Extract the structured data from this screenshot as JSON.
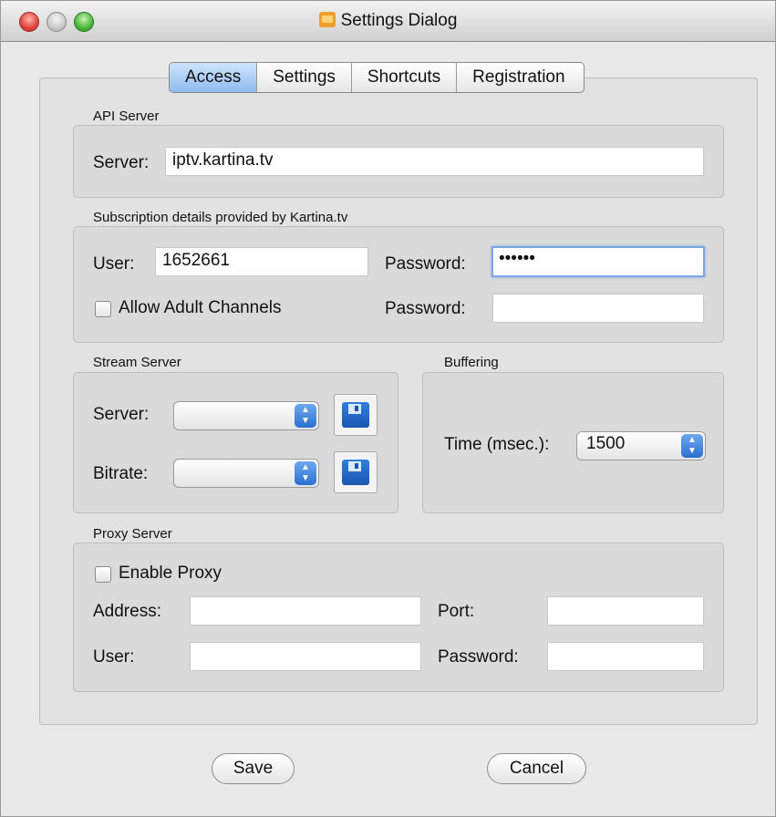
{
  "window": {
    "title": "Settings Dialog"
  },
  "tabs": [
    "Access",
    "Settings",
    "Shortcuts",
    "Registration"
  ],
  "api_server": {
    "group_label": "API Server",
    "server_label": "Server:",
    "server_value": "iptv.kartina.tv"
  },
  "subscription": {
    "group_label": "Subscription details provided by Kartina.tv",
    "user_label": "User:",
    "user_value": "1652661",
    "password_label": "Password:",
    "password_value": "••••••",
    "allow_adult_label": "Allow Adult Channels",
    "adult_password_label": "Password:",
    "adult_password_value": ""
  },
  "stream_server": {
    "group_label": "Stream Server",
    "server_label": "Server:",
    "server_value": "",
    "bitrate_label": "Bitrate:",
    "bitrate_value": ""
  },
  "buffering": {
    "group_label": "Buffering",
    "time_label": "Time (msec.):",
    "time_value": "1500"
  },
  "proxy": {
    "group_label": "Proxy Server",
    "enable_label": "Enable Proxy",
    "address_label": "Address:",
    "address_value": "",
    "port_label": "Port:",
    "port_value": "",
    "user_label": "User:",
    "user_value": "",
    "password_label": "Password:",
    "password_value": ""
  },
  "buttons": {
    "save": "Save",
    "cancel": "Cancel"
  },
  "icons": {
    "save_icon": "floppy-disk-icon",
    "app_icon": "tv-icon"
  },
  "colors": {
    "active_tab": "#8ebcf0",
    "focus_ring": "#7aa7e6",
    "stepper_blue": "#2a6fd2"
  }
}
